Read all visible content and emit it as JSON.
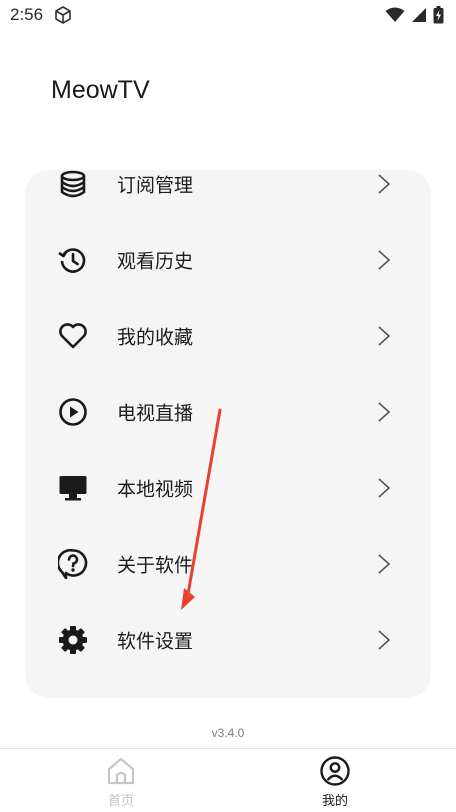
{
  "status_bar": {
    "time": "2:56"
  },
  "header": {
    "title": "MeowTV"
  },
  "menu": {
    "items": [
      {
        "label": "订阅管理",
        "icon": "database-icon"
      },
      {
        "label": "观看历史",
        "icon": "history-icon"
      },
      {
        "label": "我的收藏",
        "icon": "heart-icon"
      },
      {
        "label": "电视直播",
        "icon": "play-circle-icon"
      },
      {
        "label": "本地视频",
        "icon": "monitor-icon"
      },
      {
        "label": "关于软件",
        "icon": "help-bubble-icon"
      },
      {
        "label": "软件设置",
        "icon": "gear-icon"
      }
    ]
  },
  "footer": {
    "version": "v3.4.0"
  },
  "bottom_nav": {
    "home_label": "首页",
    "mine_label": "我的",
    "active": "mine"
  },
  "colors": {
    "card_bg": "#f5f5f5",
    "annotation_arrow": "#e8412f",
    "inactive_tab": "#c5c5c5"
  }
}
